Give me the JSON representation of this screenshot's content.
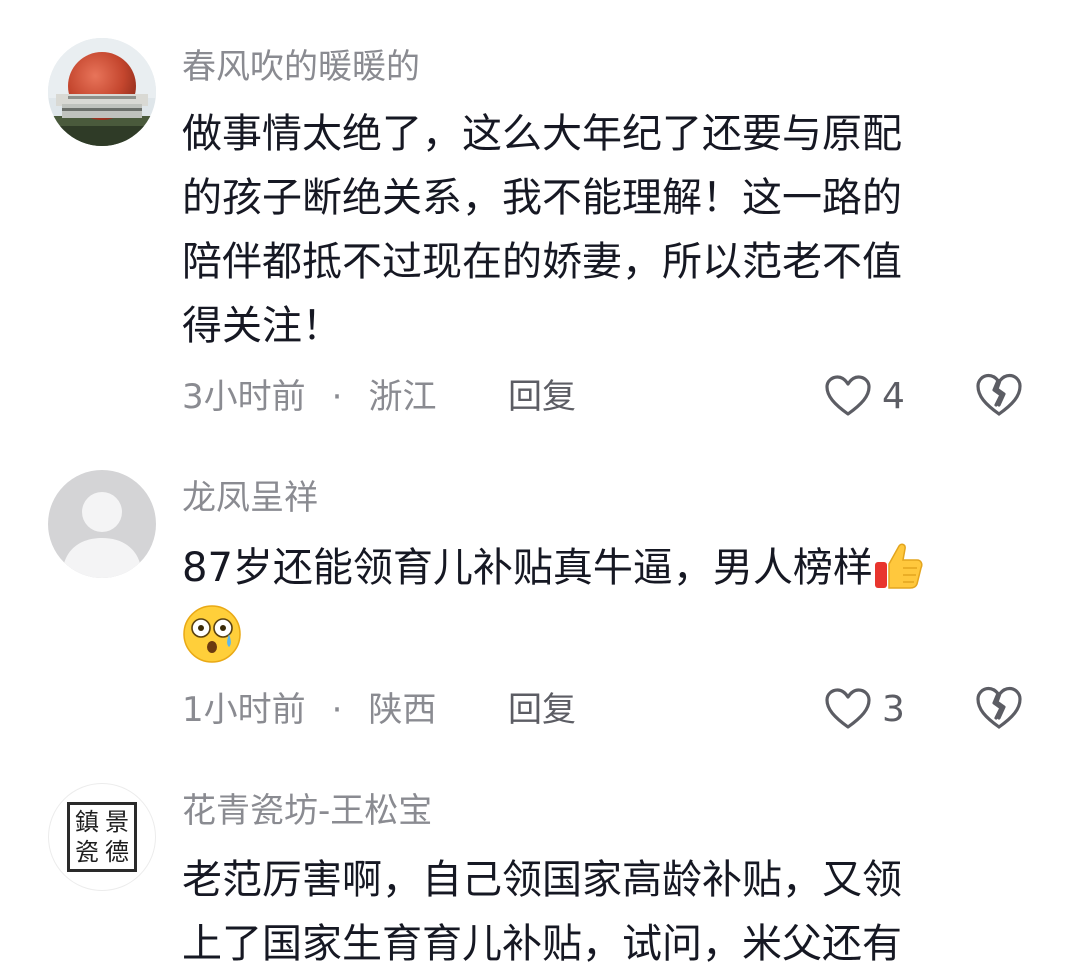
{
  "comments": [
    {
      "username": "春风吹的暖暖的",
      "lines": [
        "做事情太绝了，这么大年纪了还要与原配",
        "的孩子断绝关系，我不能理解！这一路的",
        "陪伴都抵不过现在的娇妻，所以范老不值",
        "得关注！"
      ],
      "time": "3小时前",
      "dot": "·",
      "location": "浙江",
      "reply": "回复",
      "likes": "4"
    },
    {
      "username": "龙凤呈祥",
      "text": "87岁还能领育儿补贴真牛逼，男人榜样",
      "emojis": [
        "thumbs-up-emoji",
        "dizzy-face-emoji"
      ],
      "time": "1小时前",
      "dot": "·",
      "location": "陕西",
      "reply": "回复",
      "likes": "3"
    },
    {
      "username": "花青瓷坊-王松宝",
      "avatar_text": [
        "景",
        "德",
        "鎮",
        "瓷"
      ],
      "lines": [
        "老范厉害啊，自己领国家高龄补贴，又领",
        "上了国家生育育儿补贴，试问，米父还有"
      ]
    }
  ],
  "colors": {
    "username": "#8a8b91",
    "content": "#161823",
    "meta": "#8a8b91",
    "icon": "#5c5d64"
  }
}
